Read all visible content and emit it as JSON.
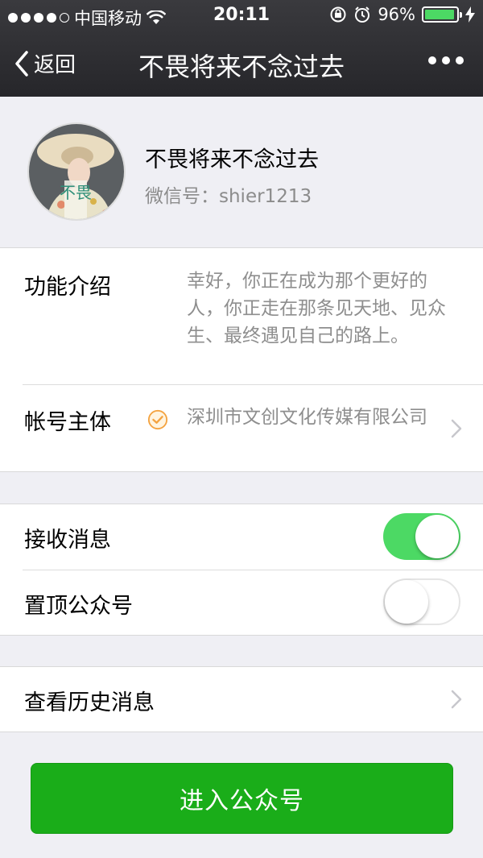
{
  "status_bar": {
    "carrier": "中国移动",
    "time": "20:11",
    "battery": "96%",
    "battery_level": 0.96
  },
  "nav": {
    "back_label": "返回",
    "title": "不畏将来不念过去"
  },
  "profile": {
    "name": "不畏将来不念过去",
    "wechat_id": "微信号：shier1213",
    "avatar_text": "不畏"
  },
  "info": {
    "intro_label": "功能介绍",
    "intro_text": "幸好，你正在成为那个更好的人，你正走在那条见天地、见众生、最终遇见自己的路上。",
    "owner_label": "帐号主体",
    "owner_text": "深圳市文创文化传媒有限公司"
  },
  "toggles": {
    "receive_label": "接收消息",
    "receive_on": true,
    "pin_label": "置顶公众号",
    "pin_on": false
  },
  "history": {
    "label": "查看历史消息"
  },
  "enter_button": {
    "label": "进入公众号"
  },
  "colors": {
    "accent_green": "#1aad19",
    "switch_on": "#4cd964",
    "verify_orange": "#f4a340"
  }
}
